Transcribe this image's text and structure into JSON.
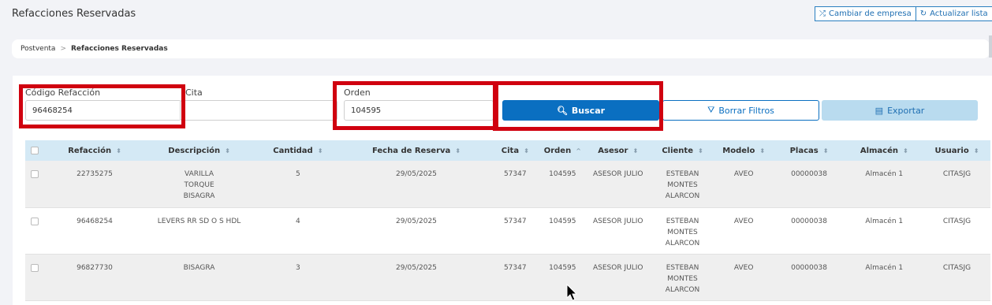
{
  "header": {
    "title": "Refacciones Reservadas",
    "change_company_label": "Cambiar de empresa",
    "refresh_label": "Actualizar lista"
  },
  "breadcrumb": {
    "parent": "Postventa",
    "separator": ">",
    "current": "Refacciones Reservadas"
  },
  "filters": {
    "codigo_label": "Código Refacción",
    "codigo_value": "96468254",
    "cita_label": "Cita",
    "cita_value": "",
    "orden_label": "Orden",
    "orden_value": "104595",
    "buscar_label": "Buscar",
    "borrar_label": "Borrar Filtros",
    "exportar_label": "Exportar"
  },
  "table": {
    "headers": [
      "Refacción",
      "Descripción",
      "Cantidad",
      "Fecha de Reserva",
      "Cita",
      "Orden",
      "Asesor",
      "Cliente",
      "Modelo",
      "Placas",
      "Almacén",
      "Usuario"
    ],
    "rows": [
      {
        "refaccion": "22735275",
        "descripcion": "VARILLA TORQUE BISAGRA",
        "cantidad": "5",
        "fecha": "29/05/2025",
        "cita": "57347",
        "orden": "104595",
        "asesor": "ASESOR JULIO",
        "cliente": "ESTEBAN MONTES ALARCON",
        "modelo": "AVEO",
        "placas": "00000038",
        "almacen": "Almacén 1",
        "usuario": "CITASJG"
      },
      {
        "refaccion": "96468254",
        "descripcion": "LEVERS RR SD O S HDL",
        "cantidad": "4",
        "fecha": "29/05/2025",
        "cita": "57347",
        "orden": "104595",
        "asesor": "ASESOR JULIO",
        "cliente": "ESTEBAN MONTES ALARCON",
        "modelo": "AVEO",
        "placas": "00000038",
        "almacen": "Almacén 1",
        "usuario": "CITASJG"
      },
      {
        "refaccion": "96827730",
        "descripcion": "BISAGRA",
        "cantidad": "3",
        "fecha": "29/05/2025",
        "cita": "57347",
        "orden": "104595",
        "asesor": "ASESOR JULIO",
        "cliente": "ESTEBAN MONTES ALARCON",
        "modelo": "AVEO",
        "placas": "00000038",
        "almacen": "Almacén 1",
        "usuario": "CITASJG"
      }
    ]
  },
  "colors": {
    "primary": "#0a6fc1",
    "highlight": "#d0000f",
    "header_row": "#d4e9f5"
  }
}
